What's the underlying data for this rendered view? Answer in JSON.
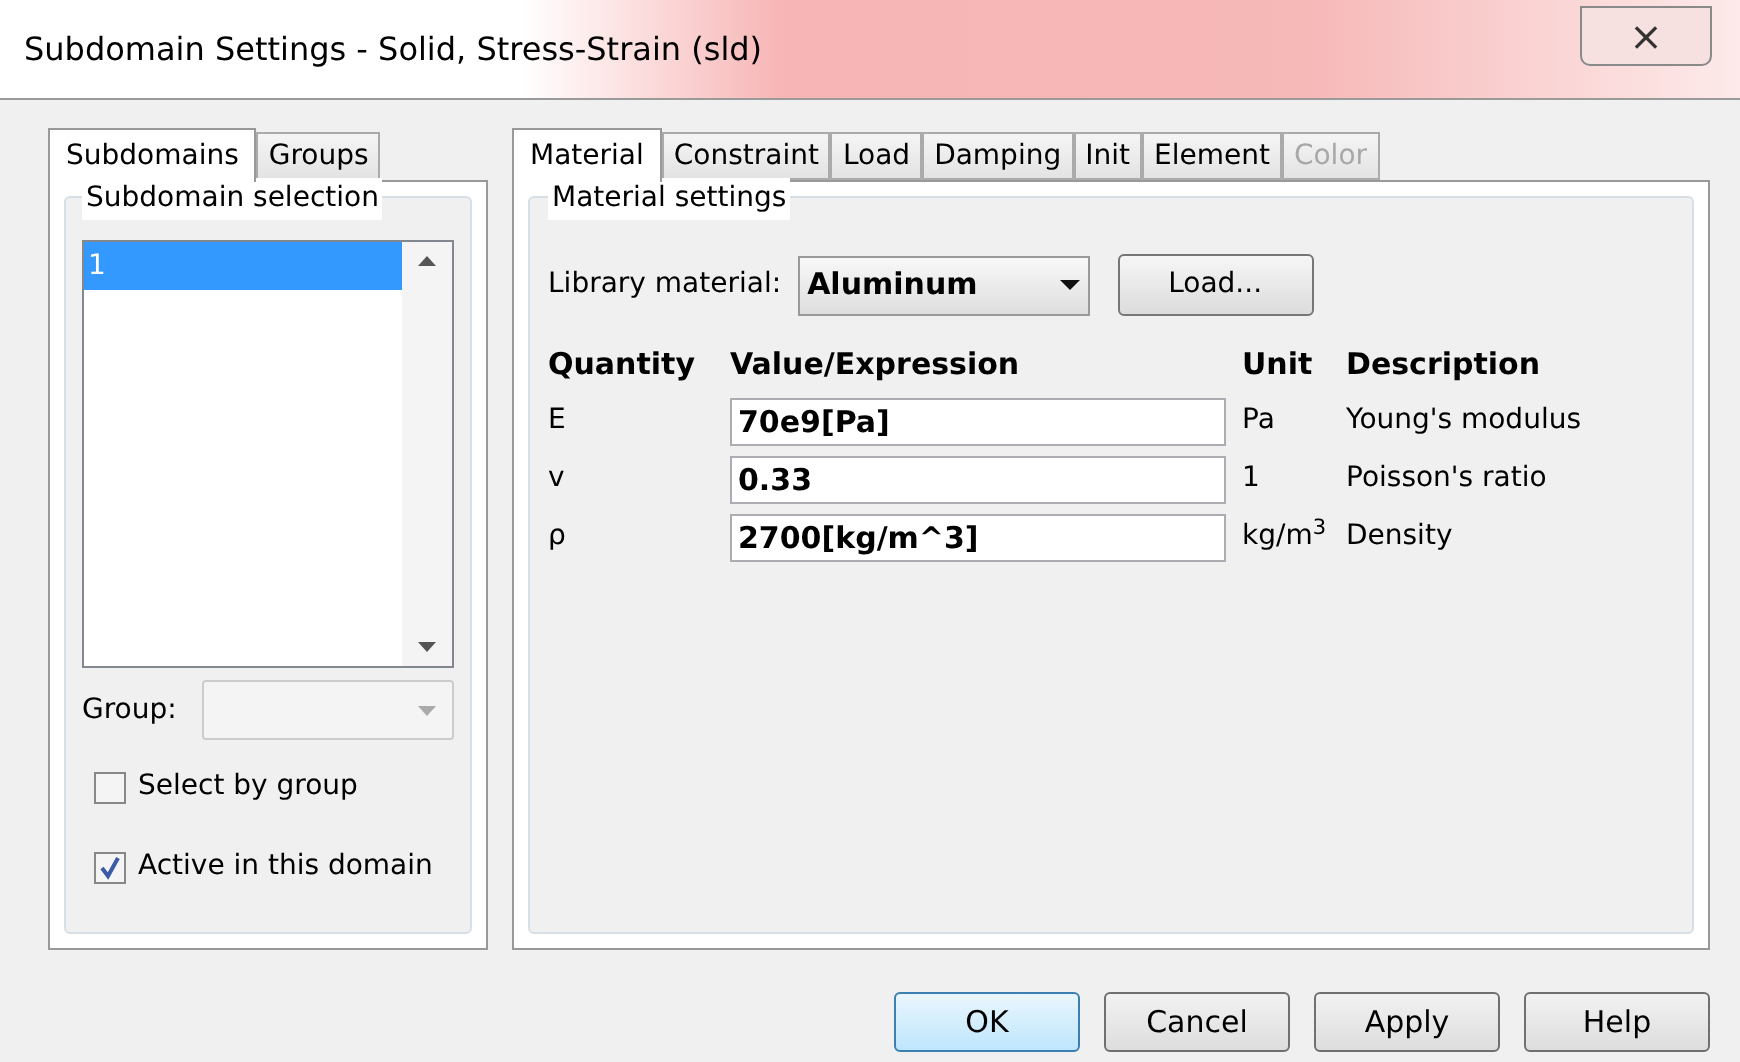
{
  "window": {
    "title": "Subdomain Settings - Solid, Stress-Strain (sld)",
    "close": "×"
  },
  "left_tabs": [
    {
      "label": "Subdomains",
      "selected": true
    },
    {
      "label": "Groups",
      "selected": false
    }
  ],
  "subdomain_selection": {
    "title": "Subdomain selection",
    "items": [
      {
        "label": "1",
        "selected": true
      }
    ],
    "group": {
      "label": "Group:",
      "disabled": true
    },
    "checkboxes": [
      {
        "label": "Select by group",
        "checked": false
      },
      {
        "label": "Active in this domain",
        "checked": true
      }
    ]
  },
  "right_tabs": [
    {
      "label": "Material",
      "selected": true,
      "disabled": false
    },
    {
      "label": "Constraint",
      "selected": false,
      "disabled": false
    },
    {
      "label": "Load",
      "selected": false,
      "disabled": false
    },
    {
      "label": "Damping",
      "selected": false,
      "disabled": false
    },
    {
      "label": "Init",
      "selected": false,
      "disabled": false
    },
    {
      "label": "Element",
      "selected": false,
      "disabled": false
    },
    {
      "label": "Color",
      "selected": false,
      "disabled": true
    }
  ],
  "material_settings": {
    "title": "Material settings",
    "library_label": "Library material:",
    "library_value": "Aluminum",
    "load_button": "Load...",
    "columns": [
      "Quantity",
      "Value/Expression",
      "Unit",
      "Description"
    ],
    "rows": [
      {
        "quantity": "E",
        "value": "70e9[Pa]",
        "unit": "Pa",
        "description": "Young's modulus"
      },
      {
        "quantity": "v",
        "value": "0.33",
        "unit": "1",
        "description": "Poisson's ratio"
      },
      {
        "quantity": "ρ",
        "value": "2700[kg/m^3]",
        "unit": "kg/m$^{3}$",
        "description": "Density"
      }
    ]
  },
  "buttons": [
    {
      "label": "OK",
      "kind": "default"
    },
    {
      "label": "Cancel",
      "kind": "normal"
    },
    {
      "label": "Apply",
      "kind": "normal"
    },
    {
      "label": "Help",
      "kind": "normal"
    }
  ]
}
